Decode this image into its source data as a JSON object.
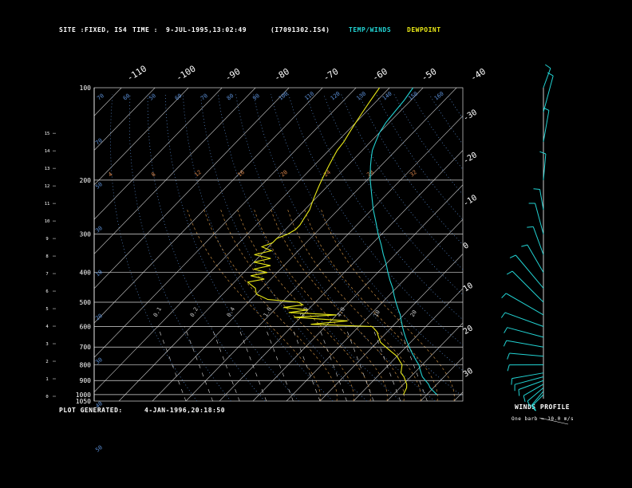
{
  "header": {
    "site_label": "SITE :",
    "site_value": "FIXED, IS4",
    "time_label": "TIME :",
    "time_value": "9-JUL-1995,13:02:49",
    "file_name": "(I7091302.IS4)",
    "legend_temp": "TEMP/WINDS",
    "legend_dewpoint": "DEWPOINT"
  },
  "footer": {
    "plot_generated_label": "PLOT GENERATED:",
    "plot_generated_value": "4-JAN-1996,20:18:50",
    "winds_profile_title": "WINDS PROFILE",
    "winds_profile_note": "One barb = 10.0 m/s"
  },
  "colors": {
    "temp": "#22d3d3",
    "dewpoint": "#e8e817",
    "grid": "#cfcfcf",
    "mixing_ratio": "#d9854a",
    "dry_adiabat": "#5b8fd6",
    "moist_adiabat": "#c48a40",
    "wind_barb": "#22d3d3"
  },
  "chart_data": {
    "type": "line",
    "subtype": "skew-t log-p",
    "y_axis": {
      "scale": "log",
      "unit": "hPa",
      "range": [
        1050,
        100
      ],
      "tick_labels": [
        "100",
        "200",
        "300",
        "400",
        "500",
        "600",
        "700",
        "800",
        "900",
        "1000",
        "1050"
      ]
    },
    "height_axis": {
      "unit": "km",
      "tick_labels": [
        "0",
        "1",
        "2",
        "3",
        "4",
        "5",
        "6",
        "7",
        "8",
        "9",
        "10",
        "11",
        "12",
        "13",
        "14",
        "15"
      ]
    },
    "temperature_labels_top": [
      "-110",
      "-100",
      "-90",
      "-80",
      "-70",
      "-60",
      "-50",
      "-40"
    ],
    "temperature_labels_right": [
      "-30",
      "-20",
      "-10",
      "0",
      "10",
      "20",
      "30"
    ],
    "dry_adiabat_labels": [
      "70",
      "60",
      "50",
      "60",
      "70",
      "80",
      "90",
      "100",
      "110",
      "120",
      "130",
      "140",
      "150",
      "160",
      "70",
      "50",
      "30",
      "10",
      "20",
      "30",
      "40",
      "50"
    ],
    "mixing_ratio_labels": [
      "4",
      "8",
      "12",
      "16",
      "20",
      "24",
      "28",
      "32"
    ],
    "moist_adiabat_labels": [
      "0.1",
      "0.2",
      "0.4",
      "1.0",
      "2.0",
      "4.0",
      "10",
      "20"
    ],
    "series": [
      {
        "name": "TEMP/WINDS",
        "points": [
          [
            1000,
            33
          ],
          [
            975,
            31
          ],
          [
            950,
            29
          ],
          [
            925,
            27.5
          ],
          [
            900,
            25.5
          ],
          [
            875,
            23.5
          ],
          [
            850,
            22
          ],
          [
            825,
            20.5
          ],
          [
            800,
            19
          ],
          [
            775,
            17
          ],
          [
            750,
            15
          ],
          [
            725,
            13
          ],
          [
            700,
            11
          ],
          [
            675,
            9
          ],
          [
            650,
            7
          ],
          [
            625,
            5
          ],
          [
            600,
            3
          ],
          [
            575,
            1
          ],
          [
            550,
            -1
          ],
          [
            525,
            -3.5
          ],
          [
            500,
            -6
          ],
          [
            475,
            -8.5
          ],
          [
            450,
            -11
          ],
          [
            425,
            -14
          ],
          [
            400,
            -17
          ],
          [
            375,
            -20
          ],
          [
            350,
            -23.5
          ],
          [
            325,
            -27
          ],
          [
            300,
            -31
          ],
          [
            275,
            -35
          ],
          [
            250,
            -39.5
          ],
          [
            225,
            -44
          ],
          [
            200,
            -49
          ],
          [
            190,
            -51
          ],
          [
            180,
            -53
          ],
          [
            170,
            -55
          ],
          [
            160,
            -57
          ],
          [
            150,
            -58.5
          ],
          [
            140,
            -60
          ],
          [
            130,
            -61
          ],
          [
            120,
            -61.5
          ],
          [
            110,
            -62
          ],
          [
            100,
            -63
          ]
        ]
      },
      {
        "name": "DEWPOINT",
        "points": [
          [
            1000,
            23
          ],
          [
            975,
            22.5
          ],
          [
            950,
            22
          ],
          [
            925,
            21
          ],
          [
            900,
            19.5
          ],
          [
            875,
            18
          ],
          [
            850,
            16
          ],
          [
            825,
            15
          ],
          [
            800,
            14
          ],
          [
            775,
            12
          ],
          [
            750,
            10
          ],
          [
            725,
            7
          ],
          [
            700,
            4
          ],
          [
            675,
            1
          ],
          [
            650,
            -1
          ],
          [
            625,
            -3
          ],
          [
            600,
            -6
          ],
          [
            590,
            -25
          ],
          [
            575,
            -15
          ],
          [
            560,
            -32
          ],
          [
            550,
            -20
          ],
          [
            540,
            -35
          ],
          [
            530,
            -30
          ],
          [
            520,
            -38
          ],
          [
            510,
            -33
          ],
          [
            500,
            -35
          ],
          [
            490,
            -45
          ],
          [
            470,
            -50
          ],
          [
            450,
            -52
          ],
          [
            430,
            -56
          ],
          [
            420,
            -52
          ],
          [
            410,
            -57
          ],
          [
            400,
            -53
          ],
          [
            390,
            -58
          ],
          [
            380,
            -54
          ],
          [
            370,
            -60
          ],
          [
            360,
            -56
          ],
          [
            350,
            -62
          ],
          [
            340,
            -58
          ],
          [
            330,
            -62
          ],
          [
            320,
            -60
          ],
          [
            310,
            -60
          ],
          [
            300,
            -58
          ],
          [
            290,
            -57
          ],
          [
            280,
            -57
          ],
          [
            270,
            -57.5
          ],
          [
            260,
            -58
          ],
          [
            250,
            -58.5
          ],
          [
            240,
            -59.5
          ],
          [
            230,
            -60.5
          ],
          [
            220,
            -61.5
          ],
          [
            210,
            -62.5
          ],
          [
            200,
            -63.5
          ],
          [
            190,
            -64.5
          ],
          [
            180,
            -65.5
          ],
          [
            170,
            -66.5
          ],
          [
            160,
            -67.5
          ],
          [
            150,
            -68
          ],
          [
            140,
            -69
          ],
          [
            130,
            -70
          ],
          [
            120,
            -71
          ],
          [
            110,
            -72
          ],
          [
            100,
            -73
          ]
        ]
      }
    ],
    "wind_barbs": [
      [
        1000,
        225,
        5
      ],
      [
        975,
        220,
        8
      ],
      [
        950,
        230,
        10
      ],
      [
        925,
        240,
        12
      ],
      [
        900,
        250,
        15
      ],
      [
        875,
        255,
        18
      ],
      [
        850,
        260,
        20
      ],
      [
        800,
        270,
        22
      ],
      [
        750,
        275,
        22
      ],
      [
        700,
        280,
        25
      ],
      [
        650,
        285,
        25
      ],
      [
        600,
        290,
        28
      ],
      [
        550,
        300,
        30
      ],
      [
        500,
        315,
        35
      ],
      [
        450,
        320,
        30
      ],
      [
        400,
        330,
        20
      ],
      [
        350,
        340,
        18
      ],
      [
        300,
        345,
        20
      ],
      [
        250,
        350,
        10
      ],
      [
        200,
        5,
        15
      ],
      [
        150,
        10,
        20
      ],
      [
        120,
        15,
        25
      ],
      [
        100,
        20,
        10
      ]
    ]
  }
}
